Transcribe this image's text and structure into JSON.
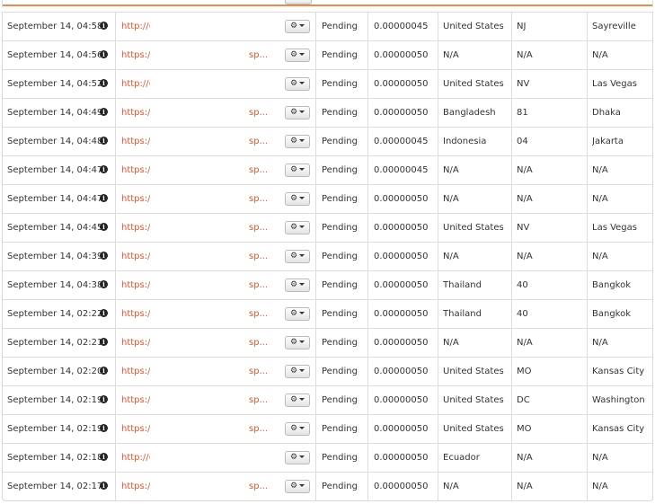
{
  "table": {
    "rows": [
      {
        "date": "September 14, 04:58",
        "url": "http://(",
        "sp": "",
        "status": "Pending",
        "amount": "0.00000045",
        "country": "United States",
        "region": "NJ",
        "city": "Sayreville"
      },
      {
        "date": "September 14, 04:56",
        "url": "https:/",
        "sp": "sp...",
        "status": "Pending",
        "amount": "0.00000050",
        "country": "N/A",
        "region": "N/A",
        "city": "N/A"
      },
      {
        "date": "September 14, 04:52",
        "url": "http://(",
        "sp": "",
        "status": "Pending",
        "amount": "0.00000050",
        "country": "United States",
        "region": "NV",
        "city": "Las Vegas"
      },
      {
        "date": "September 14, 04:49",
        "url": "https:/",
        "sp": "sp...",
        "status": "Pending",
        "amount": "0.00000050",
        "country": "Bangladesh",
        "region": "81",
        "city": "Dhaka"
      },
      {
        "date": "September 14, 04:48",
        "url": "https:/",
        "sp": "sp...",
        "status": "Pending",
        "amount": "0.00000045",
        "country": "Indonesia",
        "region": "04",
        "city": "Jakarta"
      },
      {
        "date": "September 14, 04:47",
        "url": "https:/",
        "sp": "sp...",
        "status": "Pending",
        "amount": "0.00000045",
        "country": "N/A",
        "region": "N/A",
        "city": "N/A"
      },
      {
        "date": "September 14, 04:47",
        "url": "https:/",
        "sp": "sp...",
        "status": "Pending",
        "amount": "0.00000050",
        "country": "N/A",
        "region": "N/A",
        "city": "N/A"
      },
      {
        "date": "September 14, 04:45",
        "url": "https:/",
        "sp": "sp...",
        "status": "Pending",
        "amount": "0.00000050",
        "country": "United States",
        "region": "NV",
        "city": "Las Vegas"
      },
      {
        "date": "September 14, 04:39",
        "url": "https:/",
        "sp": "sp...",
        "status": "Pending",
        "amount": "0.00000050",
        "country": "N/A",
        "region": "N/A",
        "city": "N/A"
      },
      {
        "date": "September 14, 04:38",
        "url": "https:/",
        "sp": "sp...",
        "status": "Pending",
        "amount": "0.00000050",
        "country": "Thailand",
        "region": "40",
        "city": "Bangkok"
      },
      {
        "date": "September 14, 02:22",
        "url": "https:/",
        "sp": "sp...",
        "status": "Pending",
        "amount": "0.00000050",
        "country": "Thailand",
        "region": "40",
        "city": "Bangkok"
      },
      {
        "date": "September 14, 02:21",
        "url": "https:/",
        "sp": "sp...",
        "status": "Pending",
        "amount": "0.00000050",
        "country": "N/A",
        "region": "N/A",
        "city": "N/A"
      },
      {
        "date": "September 14, 02:20",
        "url": "https:/",
        "sp": "sp...",
        "status": "Pending",
        "amount": "0.00000050",
        "country": "United States",
        "region": "MO",
        "city": "Kansas City"
      },
      {
        "date": "September 14, 02:19",
        "url": "https:/",
        "sp": "sp...",
        "status": "Pending",
        "amount": "0.00000050",
        "country": "United States",
        "region": "DC",
        "city": "Washington"
      },
      {
        "date": "September 14, 02:19",
        "url": "https:/",
        "sp": "sp...",
        "status": "Pending",
        "amount": "0.00000050",
        "country": "United States",
        "region": "MO",
        "city": "Kansas City"
      },
      {
        "date": "September 14, 02:18",
        "url": "http://(",
        "sp": "",
        "status": "Pending",
        "amount": "0.00000050",
        "country": "Ecuador",
        "region": "N/A",
        "city": "N/A"
      },
      {
        "date": "September 14, 02:17",
        "url": "https:/",
        "sp": "sp...",
        "status": "Pending",
        "amount": "0.00000050",
        "country": "N/A",
        "region": "N/A",
        "city": "N/A"
      }
    ]
  },
  "icons": {
    "info": "info-icon",
    "gear": "gear-icon",
    "caret": "caret-down-icon"
  },
  "glyphs": {
    "info": "i",
    "gear": "⚙"
  },
  "colors": {
    "link": "#e8572b",
    "accent": "#f08a4b",
    "border": "#dddddd",
    "text": "#333333"
  }
}
